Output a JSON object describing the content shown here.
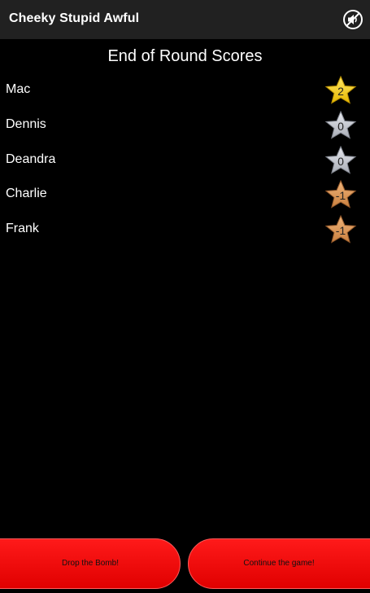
{
  "app_bar": {
    "title": "Cheeky Stupid Awful",
    "mute_icon": "speaker-muted-icon"
  },
  "screen": {
    "title": "End of Round Scores"
  },
  "scores": [
    {
      "name": "Mac",
      "score": "2",
      "medal": "gold"
    },
    {
      "name": "Dennis",
      "score": "0",
      "medal": "silver"
    },
    {
      "name": "Deandra",
      "score": "0",
      "medal": "silver"
    },
    {
      "name": "Charlie",
      "score": "-1",
      "medal": "bronze"
    },
    {
      "name": "Frank",
      "score": "-1",
      "medal": "bronze"
    }
  ],
  "medal_colors": {
    "gold": {
      "light": "#ffe766",
      "dark": "#e6b800",
      "edge": "#b88f00"
    },
    "silver": {
      "light": "#e6e8ee",
      "dark": "#a9adb6",
      "edge": "#7b7f88"
    },
    "bronze": {
      "light": "#f0b47a",
      "dark": "#c9803f",
      "edge": "#92582a"
    }
  },
  "buttons": {
    "drop_bomb": "Drop the Bomb!",
    "continue": "Continue the game!"
  }
}
